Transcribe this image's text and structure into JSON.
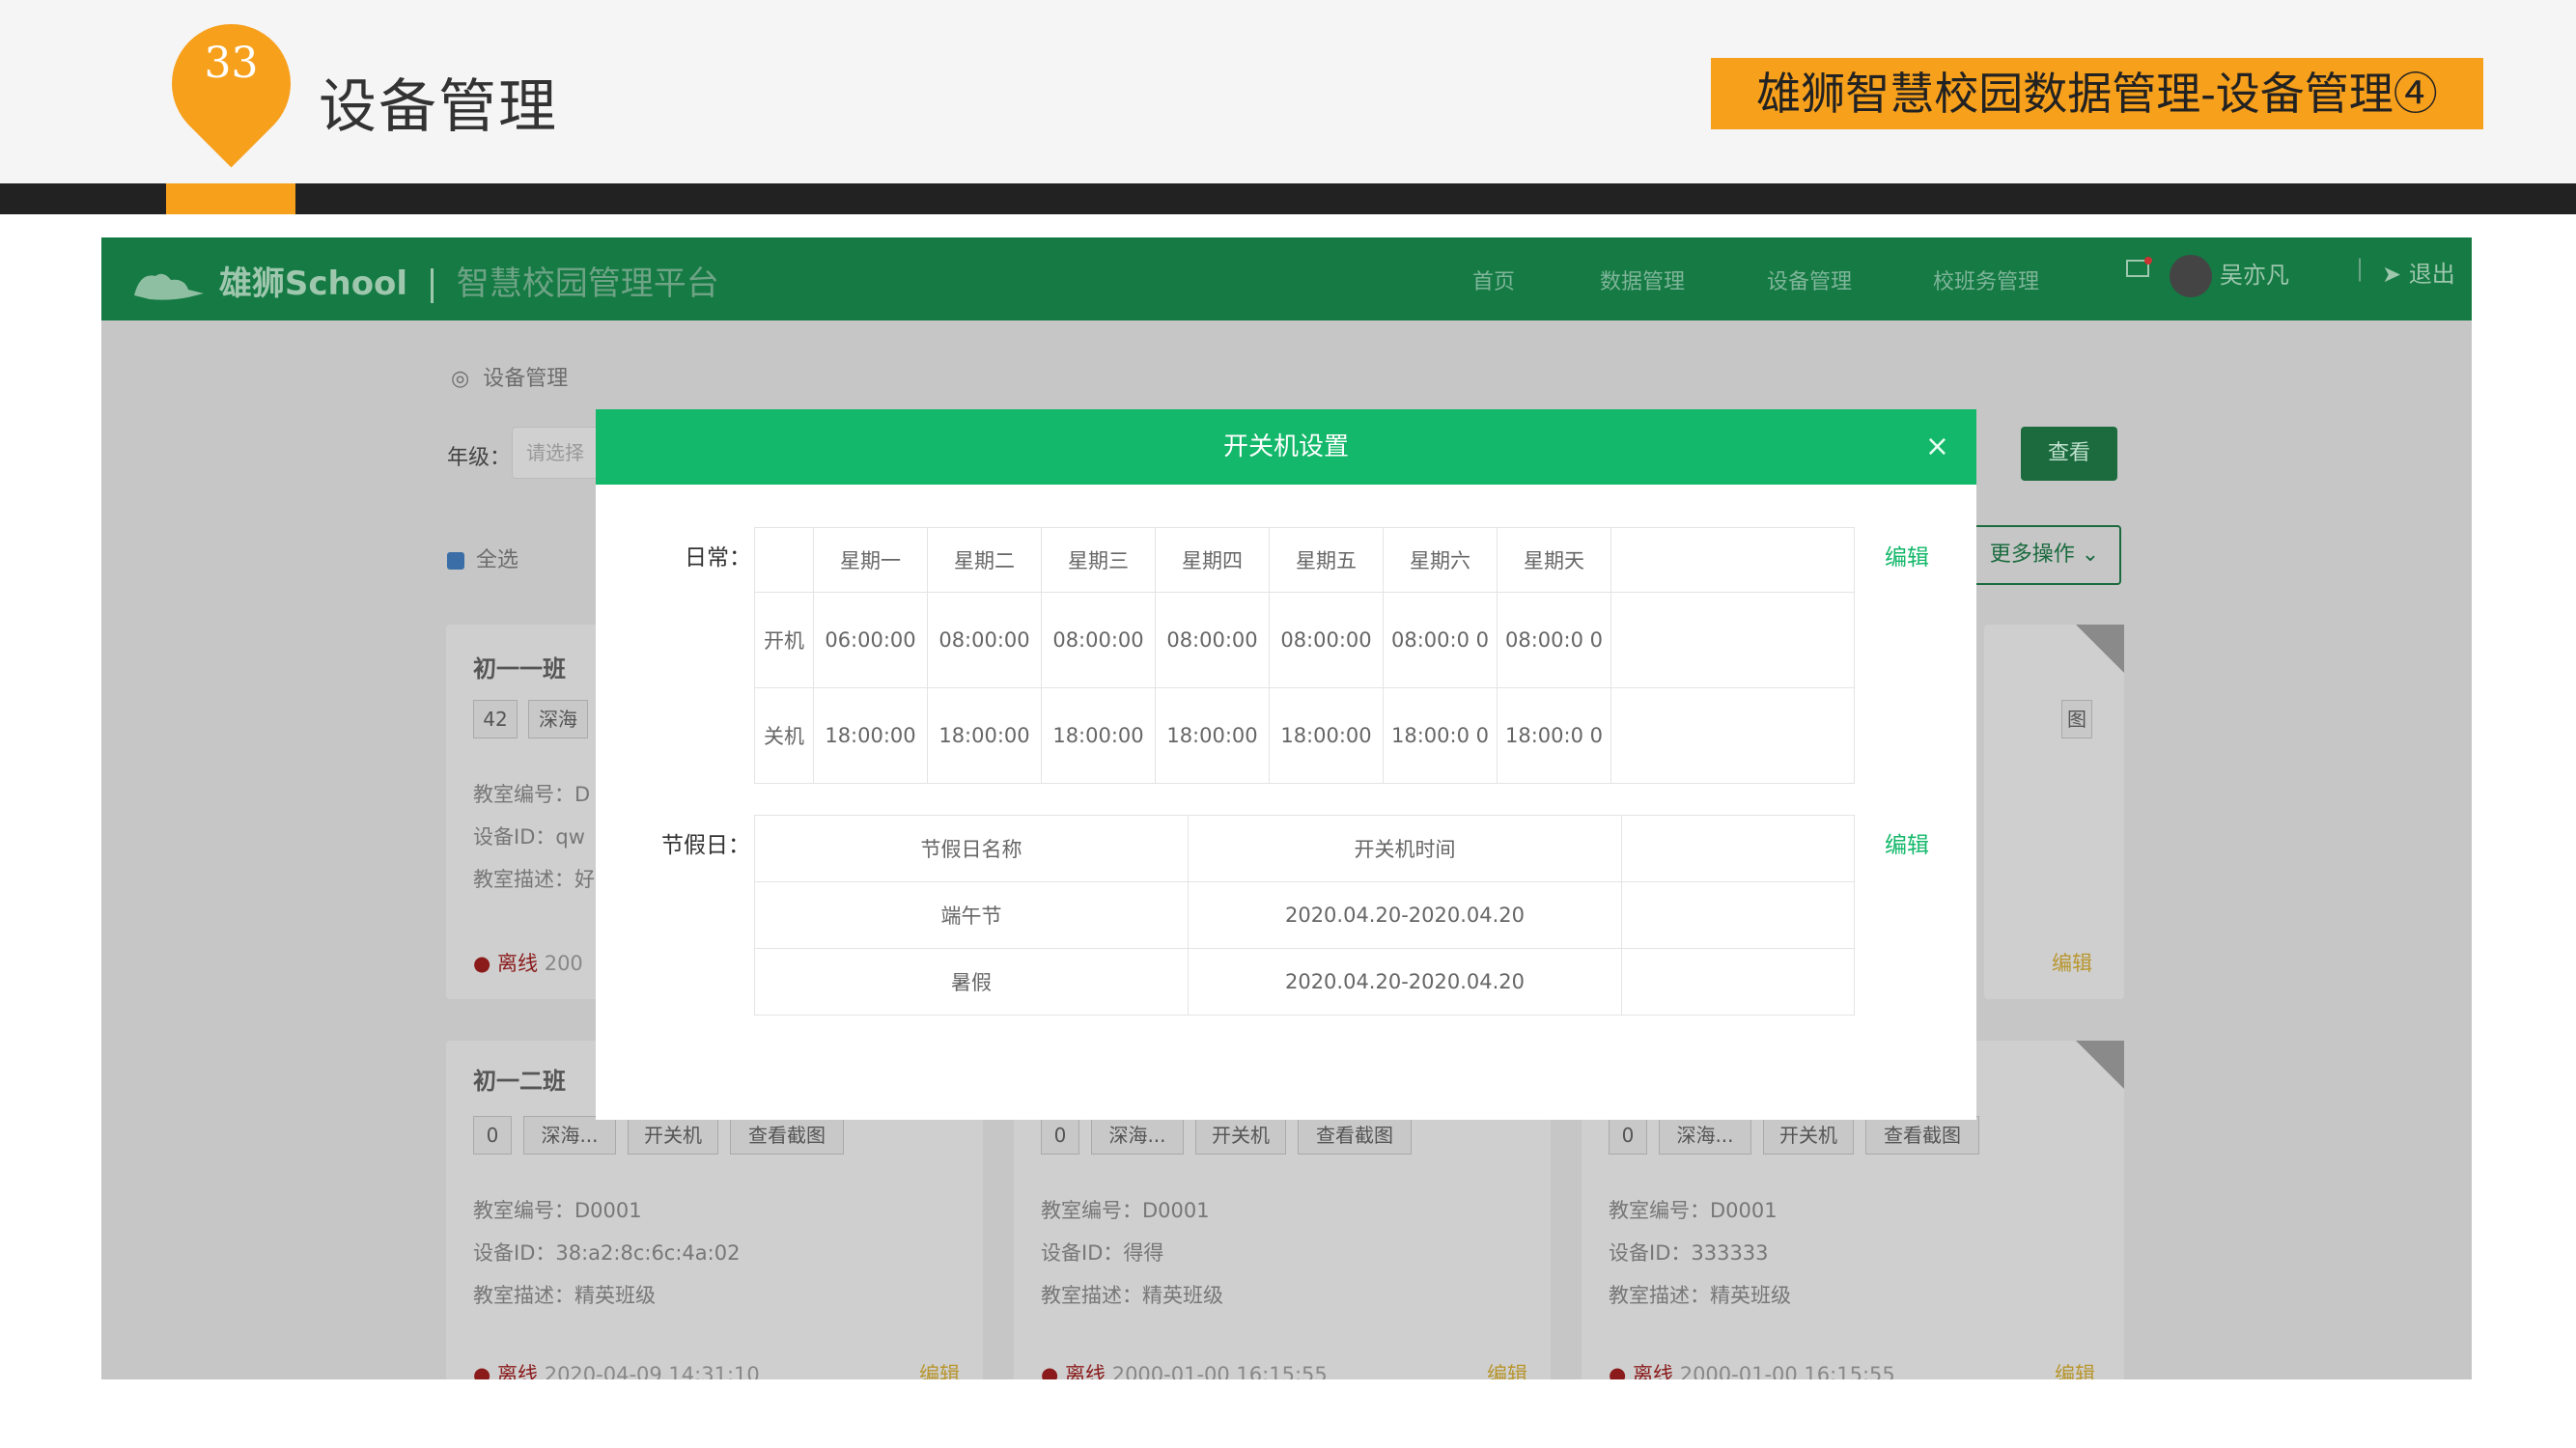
{
  "slide": {
    "page_number": "33",
    "title": "设备管理",
    "badge": "雄狮智慧校园数据管理-设备管理④"
  },
  "nav": {
    "brand": "雄狮School",
    "platform": "智慧校园管理平台",
    "items": [
      "首页",
      "数据管理",
      "设备管理",
      "校班务管理"
    ],
    "user": "吴亦凡",
    "logout": "退出"
  },
  "page": {
    "breadcrumb": "设备管理",
    "grade_label": "年级：",
    "grade_placeholder": "请选择",
    "query_button": "查看",
    "select_all": "全选",
    "more_ops": "更多操作"
  },
  "cards": [
    {
      "title": "初一一班",
      "count": "42",
      "device": "深海",
      "room": "教室编号：D",
      "device_id": "设备ID：qw",
      "desc": "教室描述：好",
      "status": "离线",
      "time": "200",
      "edit": "编辑"
    },
    {
      "title": "初一二班",
      "count": "0",
      "device": "深海...",
      "power": "开关机",
      "screenshot": "查看截图",
      "room": "教室编号：D0001",
      "device_id": "设备ID：38:a2:8c:6c:4a:02",
      "desc": "教室描述：精英班级",
      "status": "离线",
      "time": "2020-04-09 14:31:10",
      "edit": "编辑"
    },
    {
      "count": "0",
      "device": "深海...",
      "power": "开关机",
      "screenshot": "查看截图",
      "room": "教室编号：D0001",
      "device_id": "设备ID：得得",
      "desc": "教室描述：精英班级",
      "status": "离线",
      "time": "2000-01-00 16:15:55",
      "edit": "编辑"
    },
    {
      "count": "0",
      "device": "深海...",
      "power": "开关机",
      "screenshot": "查看截图",
      "room": "教室编号：D0001",
      "device_id": "设备ID：333333",
      "desc": "教室描述：精英班级",
      "status": "离线",
      "time": "2000-01-00 16:15:55",
      "edit": "编辑"
    }
  ],
  "right_card": {
    "screenshot_suffix": "图",
    "edit": "编辑"
  },
  "modal": {
    "title": "开关机设置",
    "close": "×",
    "daily_label": "日常：",
    "holiday_label": "节假日：",
    "edit": "编辑",
    "days": [
      "星期一",
      "星期二",
      "星期三",
      "星期四",
      "星期五",
      "星期六",
      "星期天"
    ],
    "on_label": "开机",
    "off_label": "关机",
    "on_times": [
      "06:00:00",
      "08:00:00",
      "08:00:00",
      "08:00:00",
      "08:00:00",
      "08:00:0 0",
      "08:00:0 0"
    ],
    "off_times": [
      "18:00:00",
      "18:00:00",
      "18:00:00",
      "18:00:00",
      "18:00:00",
      "18:00:0 0",
      "18:00:0 0"
    ],
    "holiday_headers": [
      "节假日名称",
      "开关机时间"
    ],
    "holidays": [
      {
        "name": "端午节",
        "range": "2020.04.20-2020.04.20"
      },
      {
        "name": "暑假",
        "range": "2020.04.20-2020.04.20"
      }
    ]
  }
}
